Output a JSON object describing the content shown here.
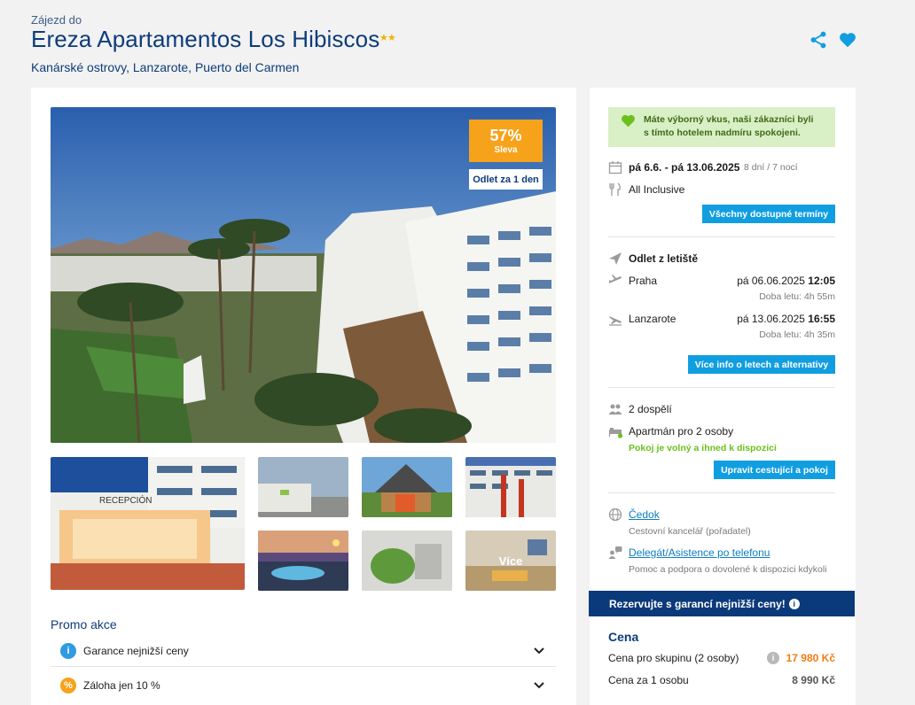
{
  "header": {
    "eyebrow": "Zájezd do",
    "title": "Ereza Apartamentos Los Hibiscos",
    "stars": "★★",
    "location": "Kanárské ostrovy, Lanzarote, Puerto del Carmen"
  },
  "gallery": {
    "discount_pct": "57%",
    "discount_label": "Sleva",
    "depart_tag": "Odlet za 1 den",
    "more_label": "Více",
    "reception_sign": "RECEPCIÓN"
  },
  "promo": {
    "title": "Promo akce",
    "items": [
      {
        "label": "Garance nejnižší ceny",
        "icon": "info-icon",
        "color": "#2f9be2",
        "glyph": "i"
      },
      {
        "label": "Záloha jen 10 %",
        "icon": "percent-icon",
        "color": "#f7a21b",
        "glyph": "%"
      }
    ]
  },
  "sidebar": {
    "notice": "Máte výborný vkus, naši zákazníci byli s tímto hotelem nadmíru spokojeni.",
    "dates": "pá 6.6. - pá 13.06.2025",
    "duration": "8 dní / 7 nocí",
    "board": "All Inclusive",
    "all_dates_button": "Všechny dostupné termíny",
    "departure_label": "Odlet z letiště",
    "outbound": {
      "city": "Praha",
      "date": "pá 06.06.2025",
      "time": "12:05",
      "duration": "Doba letu: 4h 55m"
    },
    "inbound": {
      "city": "Lanzarote",
      "date": "pá 13.06.2025",
      "time": "16:55",
      "duration": "Doba letu: 4h 35m"
    },
    "flights_button": "Více info o letech a alternativy",
    "travellers": "2 dospělí",
    "room": "Apartmán pro 2 osoby",
    "room_status": "Pokoj je volný a ihned k dispozici",
    "edit_button": "Upravit cestující a pokoj",
    "agency_link": "Čedok",
    "agency_desc": "Cestovní kancelář (pořadatel)",
    "delegate_link": "Delegát/Asistence po telefonu",
    "delegate_desc": "Pomoc a podpora o dovolené k dispozici kdykoli"
  },
  "guarantee": "Rezervujte s garancí nejnižší ceny!",
  "price": {
    "title": "Cena",
    "group_label": "Cena pro skupinu (2 osoby)",
    "group_value": "17 980 Kč",
    "person_label": "Cena za 1 osobu",
    "person_value": "8 990 Kč"
  },
  "colors": {
    "brand": "#0d3c7a",
    "accent": "#119ee0",
    "discount": "#f7a21b",
    "success": "#6ac11c"
  }
}
